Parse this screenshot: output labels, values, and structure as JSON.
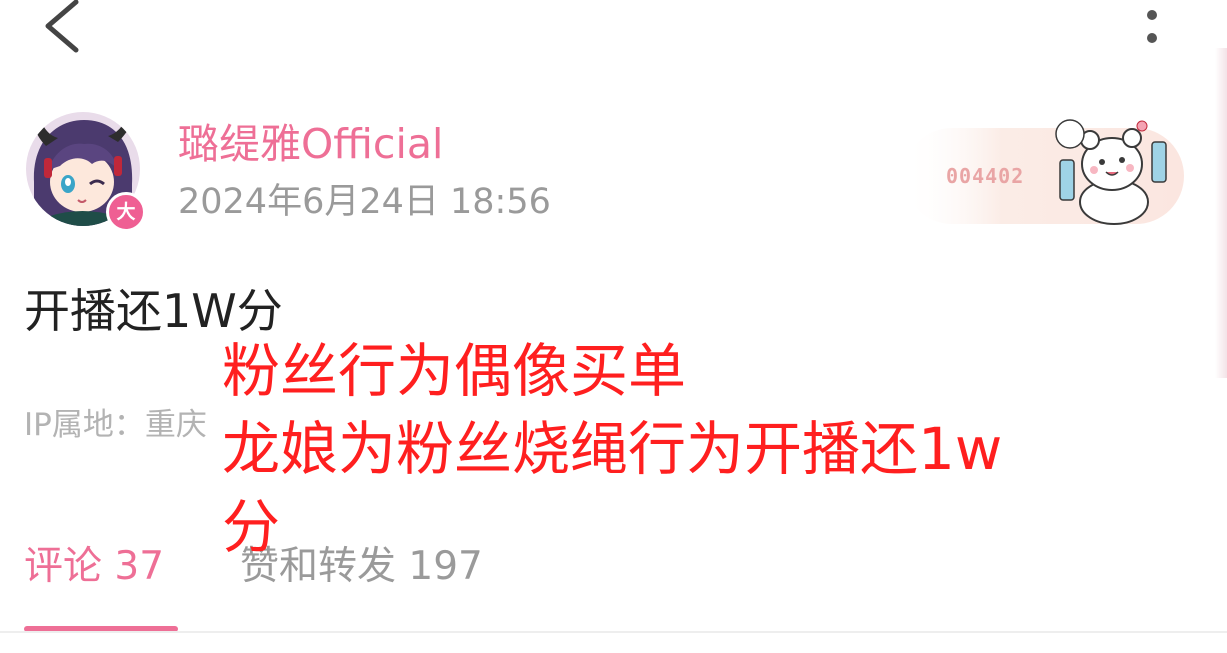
{
  "header": {
    "back_icon": "chevron-left-icon",
    "more_icon": "more-vertical-icon"
  },
  "author": {
    "name": "璐缇雅Official",
    "avatar_icon": "anime-avatar",
    "badge": "大",
    "badge_color": "#ef5f93",
    "name_color": "#ee6f96"
  },
  "post": {
    "time": "2024年6月24日 18:56",
    "content": "开播还1W分",
    "ip_location": "IP属地：重庆"
  },
  "decoration_card": {
    "number": "004402",
    "icon": "bear-mascot-icon"
  },
  "tabs": [
    {
      "label": "评论 37",
      "active": true
    },
    {
      "label": "赞和转发 197",
      "active": false
    }
  ],
  "overlay_annotation": {
    "line1": "粉丝行为偶像买单",
    "line2": "龙娘为粉丝烧绳行为开播还1w",
    "line3": "分",
    "color": "#ff1f1f"
  }
}
